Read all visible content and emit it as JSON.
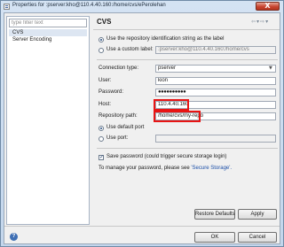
{
  "window": {
    "title": "Properties for :pserver:kho@110.4.40.160:/home/cvs/ePerolehan",
    "close_glyph": "X"
  },
  "left_panel": {
    "filter_placeholder": "type filter text",
    "items": [
      {
        "label": "CVS",
        "selected": true
      },
      {
        "label": "Server Encoding",
        "selected": false
      }
    ]
  },
  "content": {
    "title": "CVS",
    "label_mode": {
      "use_repo_string": "Use the repository identification string as the label",
      "use_custom_label": "Use a custom label:",
      "custom_label_value": ":pserver:kho@110.4.40.160:/home/cvs"
    },
    "connection_type_label": "Connection type:",
    "connection_type_value": "pserver",
    "user_label": "User:",
    "user_value": "kion",
    "password_label": "Password:",
    "password_value": "●●●●●●●●●●",
    "host_label": "Host:",
    "host_value": "110.4.40.160",
    "repo_path_label": "Repository path:",
    "repo_path_value": "/home/cvs/my-repo",
    "port": {
      "default_label": "Use default port",
      "custom_label": "Use port:"
    },
    "save_password_label": "Save password (could trigger secure storage login)",
    "manage_password_text": "To manage your password, please see",
    "secure_storage_link": "'Secure Storage'."
  },
  "buttons": {
    "restore_defaults": "Restore Defaults",
    "apply": "Apply",
    "ok": "OK",
    "cancel": "Cancel"
  },
  "colors": {
    "highlight": "#e81414",
    "link": "#1c4fa8"
  }
}
